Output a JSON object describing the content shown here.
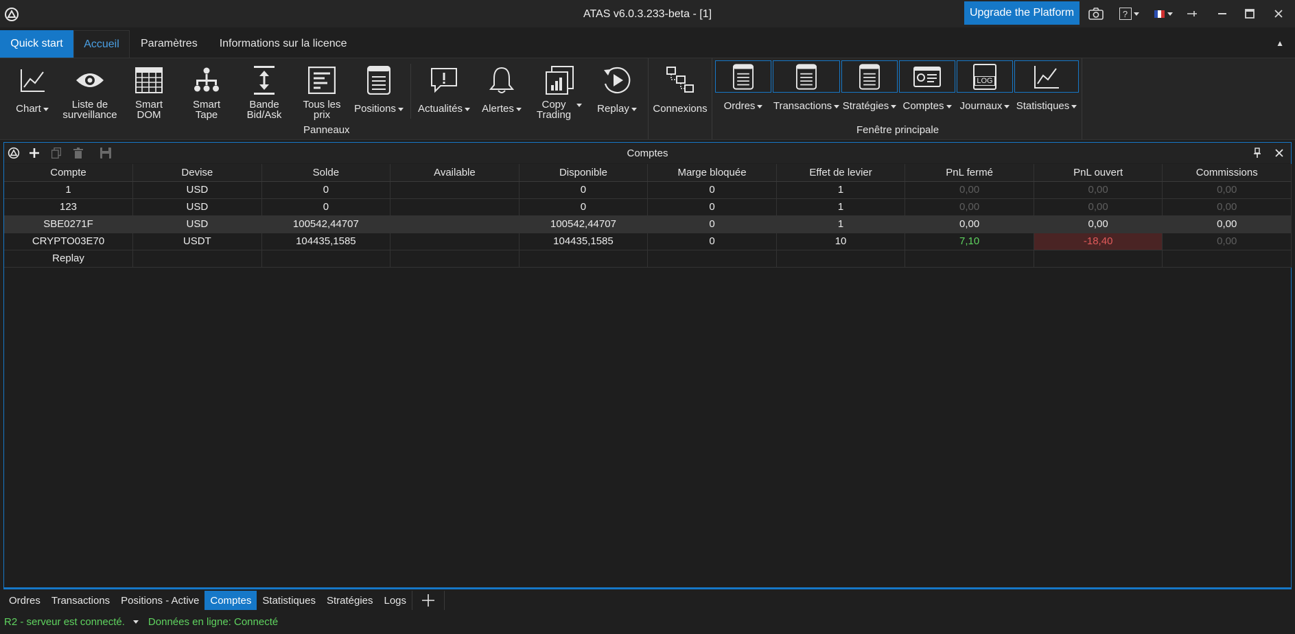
{
  "window": {
    "title": "ATAS v6.0.3.233-beta - [1]",
    "upgrade_label": "Upgrade the Platform",
    "help_label": "?"
  },
  "ribbon_tabs": [
    {
      "label": "Quick start"
    },
    {
      "label": "Accueil"
    },
    {
      "label": "Paramètres"
    },
    {
      "label": "Informations sur la licence"
    }
  ],
  "ribbon": {
    "chart": {
      "label": "Chart"
    },
    "watchlist": {
      "line1": "Liste de",
      "line2": "surveillance"
    },
    "smart_dom": {
      "line1": "Smart",
      "line2": "DOM"
    },
    "smart_tape": {
      "line1": "Smart",
      "line2": "Tape"
    },
    "bidask": {
      "line1": "Bande",
      "line2": "Bid/Ask"
    },
    "all_prices": {
      "line1": "Tous les",
      "line2": "prix"
    },
    "positions": {
      "label": "Positions"
    },
    "news": {
      "label": "Actualités"
    },
    "alerts": {
      "label": "Alertes"
    },
    "copy_trading": {
      "line1": "Copy",
      "line2": "Trading"
    },
    "replay": {
      "label": "Replay"
    },
    "connections": {
      "label": "Connexions"
    },
    "orders": {
      "label": "Ordres"
    },
    "transactions": {
      "label": "Transactions"
    },
    "strategies": {
      "label": "Stratégies"
    },
    "accounts": {
      "label": "Comptes"
    },
    "journals": {
      "label": "Journaux",
      "icon_text": "LOG"
    },
    "statistics": {
      "label": "Statistiques"
    },
    "group_panels": "Panneaux",
    "group_main": "Fenêtre principale"
  },
  "panel": {
    "title": "Comptes",
    "columns": [
      "Compte",
      "Devise",
      "Solde",
      "Available",
      "Disponible",
      "Marge bloquée",
      "Effet de levier",
      "PnL fermé",
      "PnL ouvert",
      "Commissions"
    ],
    "rows": [
      [
        "1",
        "USD",
        "0",
        "",
        "0",
        "0",
        "1",
        "0,00",
        "0,00",
        "0,00"
      ],
      [
        "123",
        "USD",
        "0",
        "",
        "0",
        "0",
        "1",
        "0,00",
        "0,00",
        "0,00"
      ],
      [
        "SBE0271F",
        "USD",
        "100542,44707",
        "",
        "100542,44707",
        "0",
        "1",
        "0,00",
        "0,00",
        "0,00"
      ],
      [
        "CRYPTO03E70",
        "USDT",
        "104435,1585",
        "",
        "104435,1585",
        "0",
        "10",
        "7,10",
        "-18,40",
        "0,00"
      ],
      [
        "Replay",
        "",
        "",
        "",
        "",
        "",
        "",
        "",
        "",
        ""
      ]
    ]
  },
  "bottom_tabs": [
    {
      "label": "Ordres"
    },
    {
      "label": "Transactions"
    },
    {
      "label": "Positions - Active"
    },
    {
      "label": "Comptes"
    },
    {
      "label": "Statistiques"
    },
    {
      "label": "Stratégies"
    },
    {
      "label": "Logs"
    }
  ],
  "status": {
    "server": "R2 - serveur est connecté.",
    "data": "Données en ligne: Connecté"
  },
  "colors": {
    "accent": "#1678c8",
    "positive": "#5fd35f",
    "negative": "#e05a5a"
  }
}
